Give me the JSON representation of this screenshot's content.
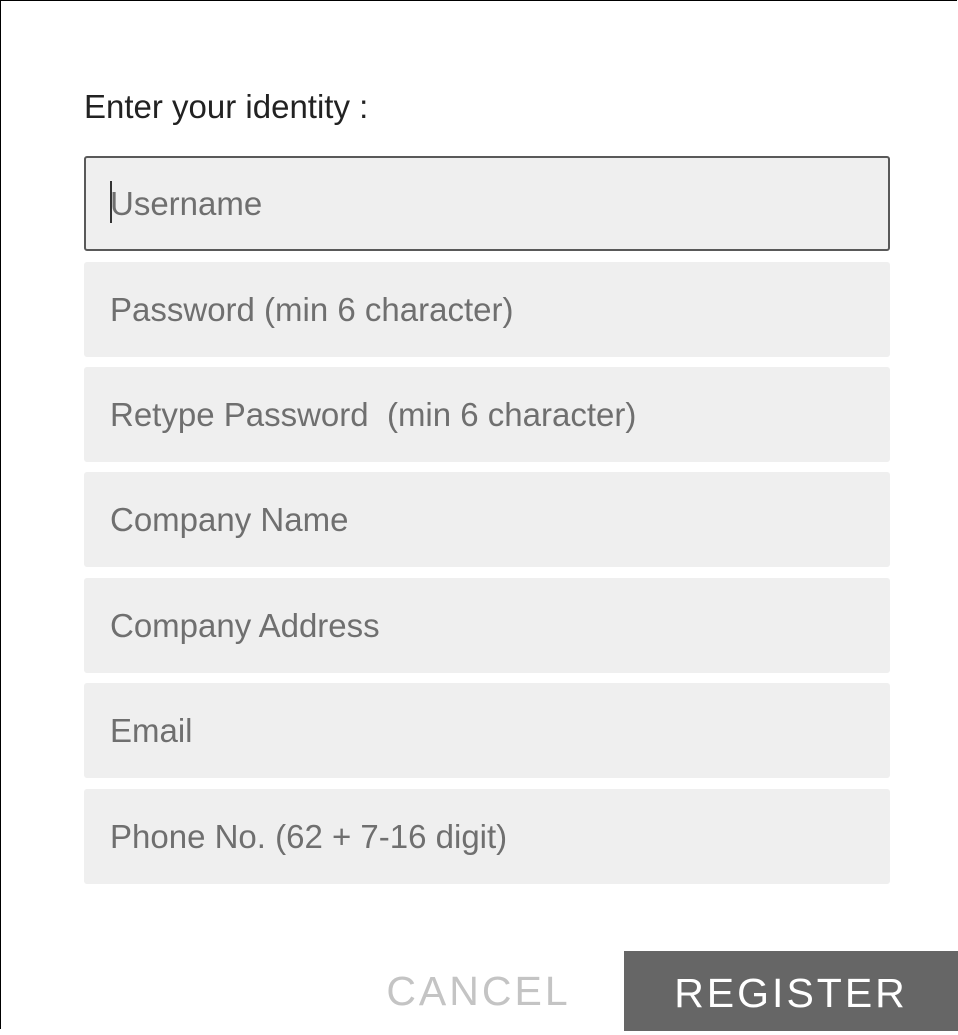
{
  "form": {
    "heading": "Enter your identity :",
    "fields": [
      {
        "name": "username",
        "value": "",
        "placeholder": "Username",
        "focused": true
      },
      {
        "name": "password",
        "value": "",
        "placeholder": "Password (min 6 character)",
        "focused": false
      },
      {
        "name": "retype_password",
        "value": "",
        "placeholder": "Retype Password  (min 6 character)",
        "focused": false
      },
      {
        "name": "company_name",
        "value": "",
        "placeholder": "Company Name",
        "focused": false
      },
      {
        "name": "company_address",
        "value": "",
        "placeholder": "Company Address",
        "focused": false
      },
      {
        "name": "email",
        "value": "",
        "placeholder": "Email",
        "focused": false
      },
      {
        "name": "phone",
        "value": "",
        "placeholder": "Phone No. (62 + 7-16 digit)",
        "focused": false
      }
    ]
  },
  "actions": {
    "cancel_label": "CANCEL",
    "register_label": "REGISTER"
  },
  "colors": {
    "field_background": "#efefef",
    "focused_border": "#595959",
    "register_background": "#666666",
    "cancel_text": "#c4c4c4"
  }
}
